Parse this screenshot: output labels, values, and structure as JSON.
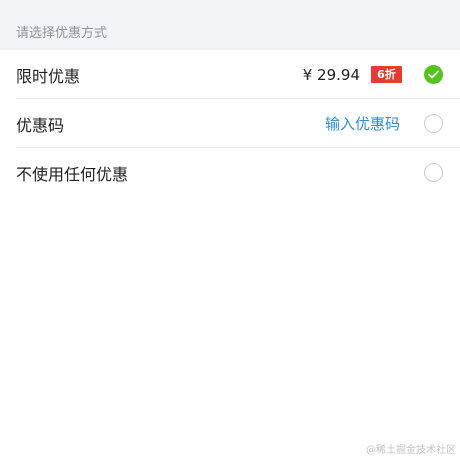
{
  "header": {
    "title": "请选择优惠方式"
  },
  "options": [
    {
      "label": "限时优惠",
      "price": "¥ 29.94",
      "badge": "6折",
      "selected": true
    },
    {
      "label": "优惠码",
      "link_text": "输入优惠码",
      "selected": false
    },
    {
      "label": "不使用任何优惠",
      "selected": false
    }
  ],
  "watermark": "@稀土掘金技术社区",
  "colors": {
    "accent_green": "#52c41a",
    "badge_red": "#e83a32",
    "link_blue": "#2d8fd6",
    "header_bg": "#f2f3f7"
  },
  "icons": {
    "selected_radio": "check-circle-icon",
    "unselected_radio": "empty-circle-icon"
  }
}
